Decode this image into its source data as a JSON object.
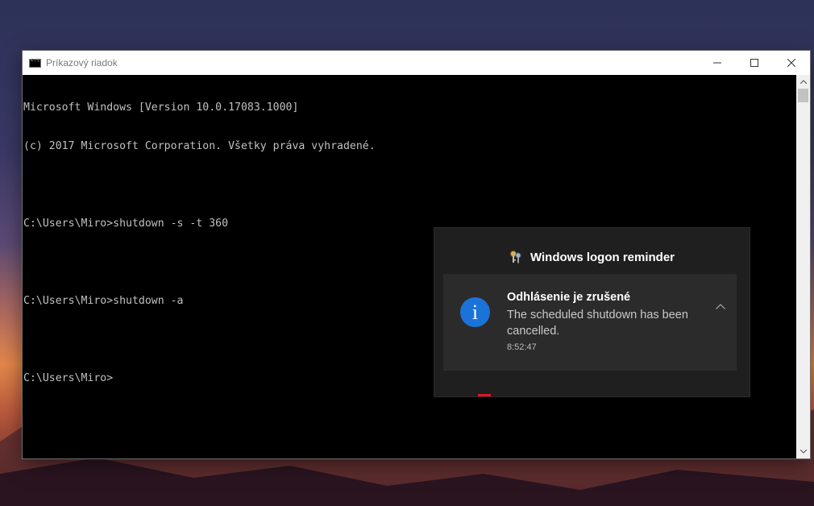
{
  "window": {
    "title": "Príkazový riadok",
    "icon": "cmd-icon",
    "controls": [
      "minimize-icon",
      "maximize-icon",
      "close-icon"
    ]
  },
  "console": {
    "lines": [
      "Microsoft Windows [Version 10.0.17083.1000]",
      "(c) 2017 Microsoft Corporation. Všetky práva vyhradené.",
      "",
      "C:\\Users\\Miro>shutdown -s -t 360",
      "",
      "C:\\Users\\Miro>shutdown -a",
      "",
      "C:\\Users\\Miro>"
    ]
  },
  "notification": {
    "app_name": "Windows logon reminder",
    "app_icon": "keys-icon",
    "title": "Odhlásenie je zrušené",
    "body": "The scheduled shutdown has been cancelled.",
    "time": "8:52:47",
    "icon": "info-icon",
    "icon_glyph": "i",
    "accent": "#1a73d8"
  }
}
